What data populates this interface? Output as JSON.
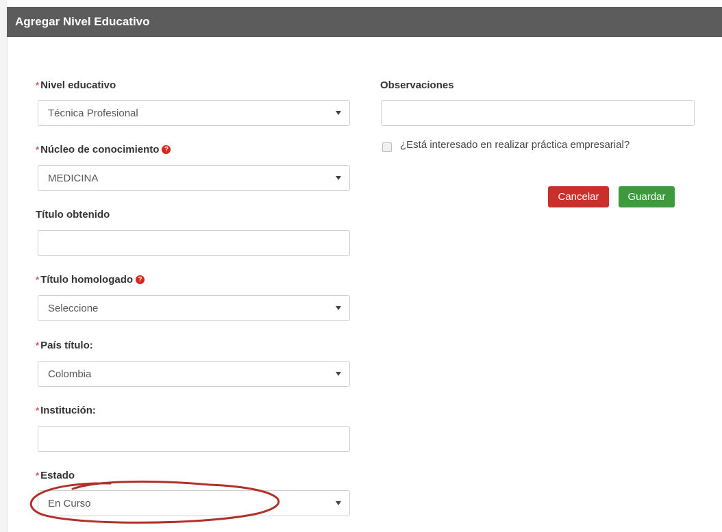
{
  "header": {
    "title": "Agregar Nivel Educativo"
  },
  "required_marker": "*",
  "help_glyph": "?",
  "form": {
    "nivel_educativo": {
      "label": "Nivel educativo",
      "value": "Técnica Profesional"
    },
    "nucleo_conocimiento": {
      "label": "Núcleo de conocimiento",
      "value": "MEDICINA"
    },
    "titulo_obtenido": {
      "label": "Título obtenido",
      "value": ""
    },
    "titulo_homologado": {
      "label": "Título homologado",
      "value": "Seleccione"
    },
    "pais_titulo": {
      "label": "País título:",
      "value": "Colombia"
    },
    "institucion": {
      "label": "Institución:",
      "value": ""
    },
    "estado": {
      "label": "Estado",
      "value": "En Curso"
    },
    "observaciones": {
      "label": "Observaciones",
      "value": ""
    },
    "practica": {
      "label": "¿Está interesado en realizar práctica empresarial?",
      "checked": false
    }
  },
  "buttons": {
    "cancel": "Cancelar",
    "save": "Guardar"
  },
  "colors": {
    "header_bg": "#5c5c5c",
    "cancel": "#c9302c",
    "save": "#3d9b3d",
    "required": "#d9534f",
    "annotation": "#b0302a"
  }
}
